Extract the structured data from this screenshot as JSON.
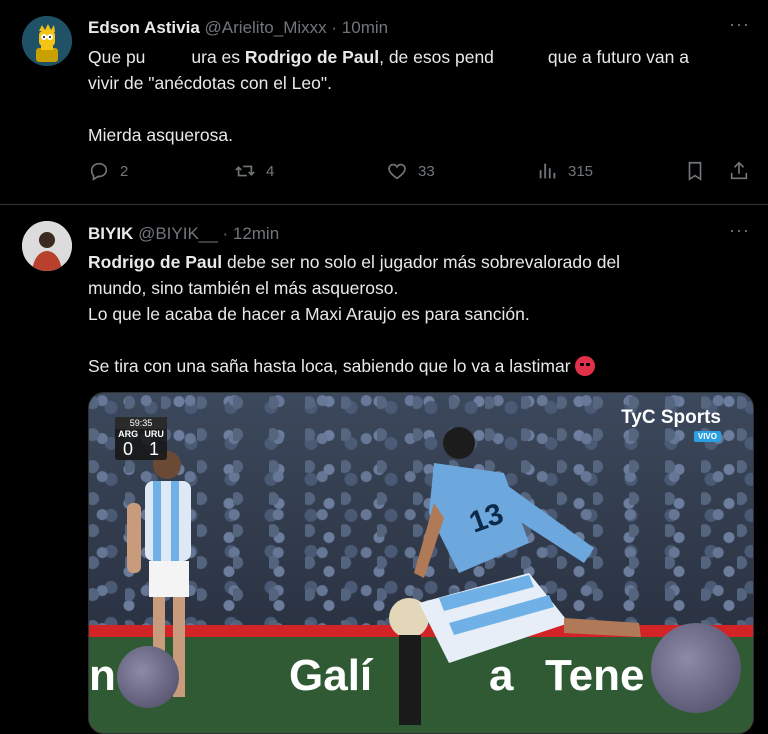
{
  "tweets": [
    {
      "author_name": "Edson Astivia",
      "handle": "@Arielito_Mixxx",
      "dot": "·",
      "time": "10min",
      "more": "···",
      "lines": [
        {
          "pre": "Que pu",
          "post": "ura es ",
          "bold": "Rodrigo de Paul",
          "tail": ", de esos pend",
          "tail2": "que a futuro van a"
        },
        {
          "text": "vivir de \"anécdotas con el Leo\"."
        },
        {
          "text": "Mierda asquerosa."
        }
      ],
      "actions": {
        "replies": "2",
        "reposts": "4",
        "likes": "33",
        "views": "315"
      }
    },
    {
      "author_name": "BIYIK",
      "handle": "@BIYIK__",
      "dot": "·",
      "time": "12min",
      "more": "···",
      "lines": [
        {
          "bold": "Rodrigo de Paul",
          "rest": " debe ser no solo el jugador más sobrevalorado del"
        },
        {
          "text": "mundo, sino también el más asqueroso."
        },
        {
          "text": "Lo que le acaba de hacer a Maxi Araujo es para sanción."
        },
        {
          "text": "Se tira con una saña hasta loca, sabiendo que lo va a lastimar"
        }
      ],
      "media": {
        "clock": "59:35",
        "team_home": "ARG",
        "team_away": "URU",
        "score_home": "0",
        "score_away": "1",
        "broadcaster": "TyC Sports",
        "live_badge": "VIVO",
        "board_texts": [
          "né",
          "Galí",
          "a",
          "Tene"
        ]
      }
    }
  ],
  "icons": {
    "reply": "reply-icon",
    "repost": "repost-icon",
    "like": "heart-icon",
    "views": "views-icon",
    "bookmark": "bookmark-icon",
    "share": "share-icon",
    "angry": "angry-face-emoji"
  },
  "colors": {
    "background": "#000000",
    "text": "#e7e9ea",
    "muted": "#71767b",
    "divider": "#2f3336"
  }
}
